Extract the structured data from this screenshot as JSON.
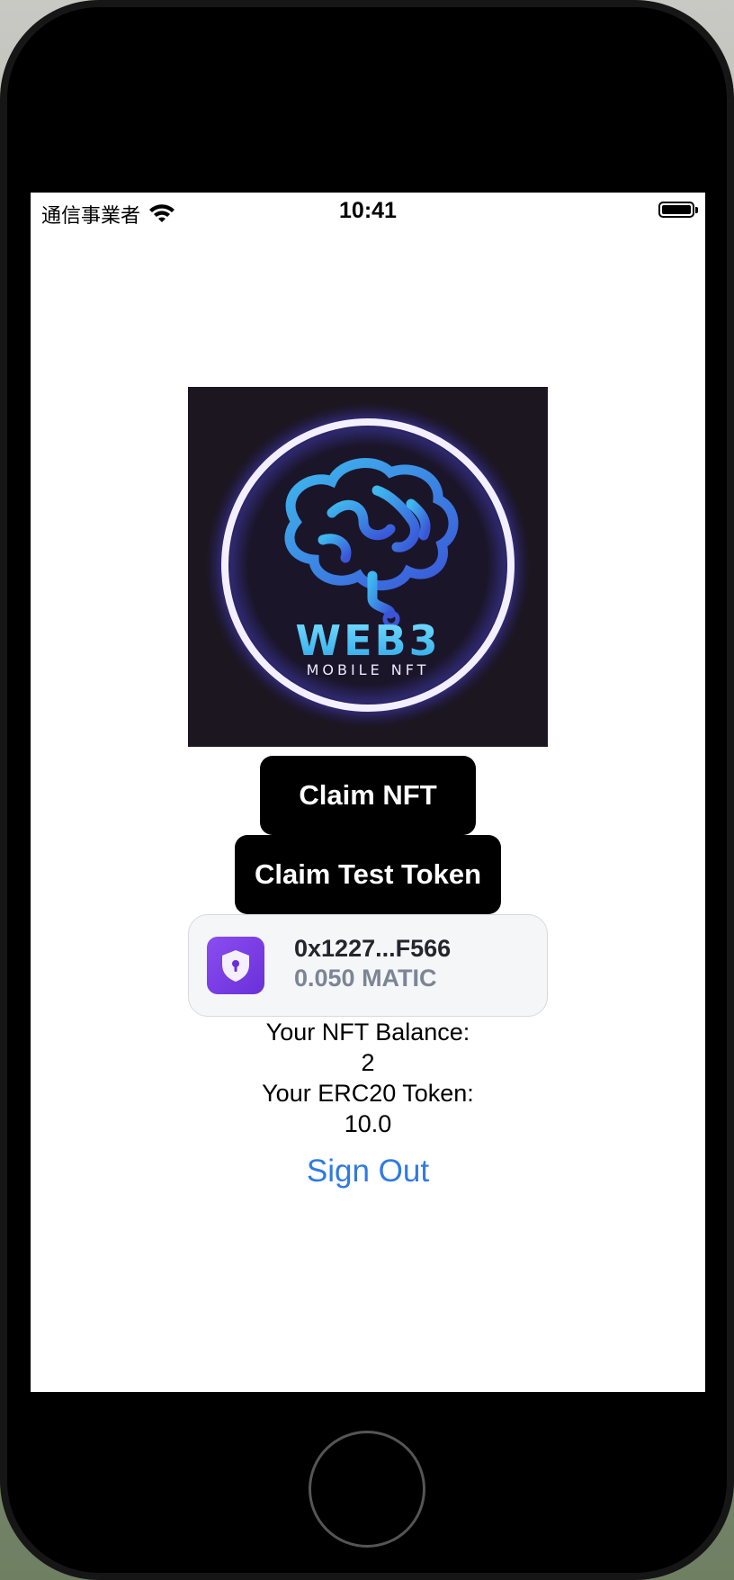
{
  "status_bar": {
    "carrier": "通信事業者",
    "time": "10:41"
  },
  "nft": {
    "logo_text": "WEB3",
    "logo_subtext": "MOBILE NFT"
  },
  "buttons": {
    "claim_nft": "Claim NFT",
    "claim_test_token": "Claim Test Token",
    "sign_out": "Sign Out"
  },
  "wallet": {
    "address": "0x1227...F566",
    "balance": "0.050 MATIC"
  },
  "balances": {
    "nft_label": "Your NFT Balance:",
    "nft_value": "2",
    "erc20_label": "Your ERC20 Token:",
    "erc20_value": "10.0"
  },
  "colors": {
    "accent": "#2f7ae4",
    "wallet_icon": "#7a3ee6",
    "logo_glow": "#5a54ff",
    "logo_brain": "#3aa8e8"
  }
}
